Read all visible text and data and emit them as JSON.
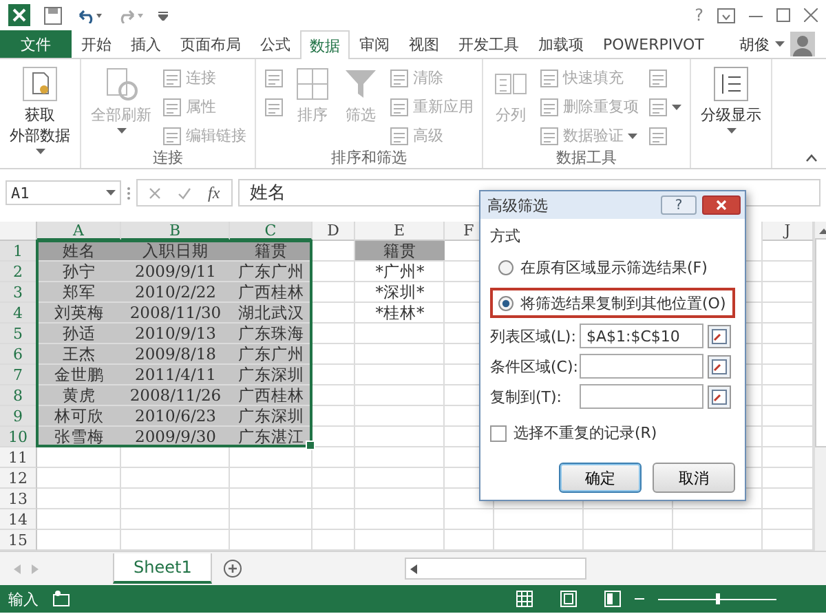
{
  "title_bar": {
    "help": "?"
  },
  "tabs": [
    {
      "label": "文件",
      "kind": "file",
      "selected": false
    },
    {
      "label": "开始",
      "kind": "tab",
      "selected": false
    },
    {
      "label": "插入",
      "kind": "tab",
      "selected": false
    },
    {
      "label": "页面布局",
      "kind": "tab",
      "selected": false
    },
    {
      "label": "公式",
      "kind": "tab",
      "selected": false
    },
    {
      "label": "数据",
      "kind": "tab",
      "selected": true
    },
    {
      "label": "审阅",
      "kind": "tab",
      "selected": false
    },
    {
      "label": "视图",
      "kind": "tab",
      "selected": false
    },
    {
      "label": "开发工具",
      "kind": "tab",
      "selected": false
    },
    {
      "label": "加载项",
      "kind": "tab",
      "selected": false
    },
    {
      "label": "POWERPIVOT",
      "kind": "tab",
      "selected": false
    }
  ],
  "user": {
    "name": "胡俊"
  },
  "ribbon_groups": [
    {
      "columns": [
        {
          "kind": "large",
          "lines": [
            "获取",
            "外部数据"
          ],
          "dropdown": true,
          "disabled": false
        }
      ]
    },
    {
      "label": "连接",
      "columns": [
        {
          "kind": "large",
          "lines": [
            "全部刷新"
          ],
          "dropdown": true,
          "disabled": true
        },
        {
          "kind": "stack",
          "items": [
            {
              "label": "连接",
              "disabled": true
            },
            {
              "label": "属性",
              "disabled": true
            },
            {
              "label": "编辑链接",
              "disabled": true
            }
          ]
        }
      ]
    },
    {
      "label": "排序和筛选",
      "columns": [
        {
          "kind": "stack",
          "items": [
            {
              "disabled": true
            },
            {
              "disabled": true
            }
          ]
        },
        {
          "kind": "large",
          "lines": [
            "排序"
          ],
          "disabled": true
        },
        {
          "kind": "large",
          "lines": [
            "筛选"
          ],
          "disabled": true
        },
        {
          "kind": "stack",
          "items": [
            {
              "label": "清除",
              "disabled": true
            },
            {
              "label": "重新应用",
              "disabled": true
            },
            {
              "label": "高级",
              "disabled": true
            }
          ]
        }
      ]
    },
    {
      "label": "数据工具",
      "columns": [
        {
          "kind": "large",
          "lines": [
            "分列"
          ],
          "disabled": true
        },
        {
          "kind": "stack",
          "items": [
            {
              "label": "快速填充",
              "disabled": true
            },
            {
              "label": "删除重复项",
              "disabled": true
            },
            {
              "label": "数据验证",
              "dropdown": true,
              "disabled": true
            }
          ]
        },
        {
          "kind": "stack",
          "items": [
            {
              "disabled": true
            },
            {
              "dropdown": true,
              "disabled": true
            },
            {
              "disabled": true
            }
          ]
        }
      ]
    },
    {
      "columns": [
        {
          "kind": "large",
          "lines": [
            "分级显示"
          ],
          "dropdown": true,
          "disabled": false
        }
      ]
    }
  ],
  "formula_bar": {
    "name_box": "A1",
    "fx": "fx",
    "content": "姓名"
  },
  "sheet": {
    "columns": [
      {
        "label": "A"
      },
      {
        "label": "B"
      },
      {
        "label": "C"
      },
      {
        "label": "D"
      },
      {
        "label": "E"
      },
      {
        "label": "F"
      },
      {
        "label": "J"
      }
    ],
    "rows": [
      {
        "number": "1",
        "cells": {
          "A": {
            "text": "姓名",
            "kind": "selected-header"
          },
          "B": {
            "text": "入职日期",
            "kind": "selected-header"
          },
          "C": {
            "text": "籍贯",
            "kind": "selected-header"
          },
          "E": {
            "text": "籍贯",
            "kind": "header"
          }
        }
      },
      {
        "number": "2",
        "cells": {
          "A": {
            "text": "孙宁",
            "kind": "selected"
          },
          "B": {
            "text": "2009/9/11",
            "kind": "selected"
          },
          "C": {
            "text": "广东广州",
            "kind": "selected"
          },
          "E": {
            "text": "*广州*",
            "kind": "plain"
          }
        }
      },
      {
        "number": "3",
        "cells": {
          "A": {
            "text": "郑军",
            "kind": "selected"
          },
          "B": {
            "text": "2010/2/22",
            "kind": "selected"
          },
          "C": {
            "text": "广西桂林",
            "kind": "selected"
          },
          "E": {
            "text": "*深圳*",
            "kind": "plain"
          }
        }
      },
      {
        "number": "4",
        "cells": {
          "A": {
            "text": "刘英梅",
            "kind": "selected"
          },
          "B": {
            "text": "2008/11/30",
            "kind": "selected"
          },
          "C": {
            "text": "湖北武汉",
            "kind": "selected"
          },
          "E": {
            "text": "*桂林*",
            "kind": "plain"
          }
        }
      },
      {
        "number": "5",
        "cells": {
          "A": {
            "text": "孙适",
            "kind": "selected"
          },
          "B": {
            "text": "2010/9/13",
            "kind": "selected"
          },
          "C": {
            "text": "广东珠海",
            "kind": "selected"
          }
        }
      },
      {
        "number": "6",
        "cells": {
          "A": {
            "text": "王杰",
            "kind": "selected"
          },
          "B": {
            "text": "2009/8/18",
            "kind": "selected"
          },
          "C": {
            "text": "广东广州",
            "kind": "selected"
          }
        }
      },
      {
        "number": "7",
        "cells": {
          "A": {
            "text": "金世鹏",
            "kind": "selected"
          },
          "B": {
            "text": "2011/4/11",
            "kind": "selected"
          },
          "C": {
            "text": "广东深圳",
            "kind": "selected"
          }
        }
      },
      {
        "number": "8",
        "cells": {
          "A": {
            "text": "黄虎",
            "kind": "selected"
          },
          "B": {
            "text": "2008/11/26",
            "kind": "selected"
          },
          "C": {
            "text": "广西桂林",
            "kind": "selected"
          }
        }
      },
      {
        "number": "9",
        "cells": {
          "A": {
            "text": "林可欣",
            "kind": "selected"
          },
          "B": {
            "text": "2010/6/23",
            "kind": "selected"
          },
          "C": {
            "text": "广东深圳",
            "kind": "selected"
          }
        }
      },
      {
        "number": "10",
        "cells": {
          "A": {
            "text": "张雪梅",
            "kind": "selected"
          },
          "B": {
            "text": "2009/9/30",
            "kind": "selected"
          },
          "C": {
            "text": "广东湛江",
            "kind": "selected"
          }
        }
      },
      {
        "number": "11",
        "cells": {}
      },
      {
        "number": "12",
        "cells": {}
      },
      {
        "number": "13",
        "cells": {}
      },
      {
        "number": "14",
        "cells": {}
      },
      {
        "number": "15",
        "cells": {}
      }
    ]
  },
  "sheet_tabs": [
    {
      "label": "Sheet1",
      "selected": true
    }
  ],
  "status_bar": {
    "mode": "输入",
    "zoom": {
      "level": 0.5
    }
  },
  "dialog": {
    "title": "高级筛选",
    "help": "?",
    "section": "方式",
    "options": [
      {
        "label": "在原有区域显示筛选结果(F)",
        "selected": false,
        "highlighted": false
      },
      {
        "label": "将筛选结果复制到其他位置(O)",
        "selected": true,
        "highlighted": true
      }
    ],
    "fields": [
      {
        "label": "列表区域(L):",
        "value": "$A$1:$C$10"
      },
      {
        "label": "条件区域(C):"
      },
      {
        "label": "复制到(T):"
      }
    ],
    "unique": {
      "label": "选择不重复的记录(R)",
      "checked": false
    },
    "buttons": [
      {
        "label": "确定",
        "kind": "default"
      },
      {
        "label": "取消",
        "kind": "normal"
      }
    ]
  }
}
